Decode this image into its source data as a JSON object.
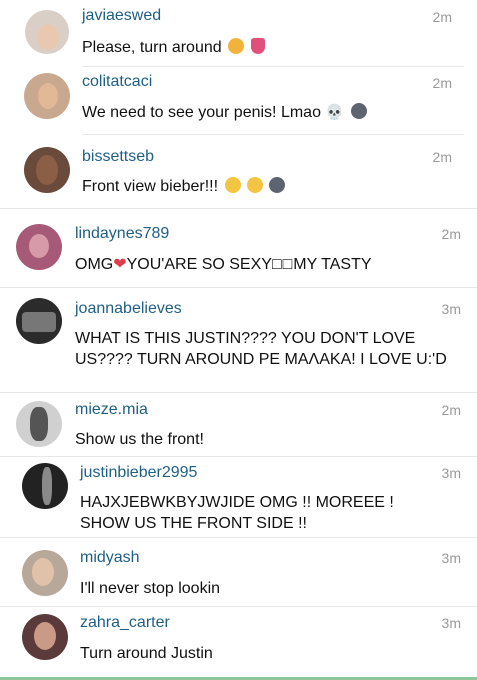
{
  "comments": [
    {
      "username": "javiaeswed",
      "text": "Please, turn around",
      "time": "2m",
      "emoji": [
        "cat-face-heart-eyes",
        "tongue"
      ]
    },
    {
      "username": "colitatcaci",
      "text": "We need to see your penis! Lmao",
      "time": "2m",
      "emoji": [
        "skull",
        "dark-moon-face"
      ]
    },
    {
      "username": "bissettseb",
      "text": "Front view bieber!!!",
      "time": "2m",
      "emoji": [
        "flushed-face",
        "smirk-face",
        "dark-moon-face"
      ]
    },
    {
      "username": "lindaynes789",
      "text_before": "OMG",
      "text_after": "YOU'ARE SO SEXY",
      "text_after2": "MY TASTY",
      "boxes": "□□",
      "time": "2m",
      "emoji": [
        "red-heart"
      ]
    },
    {
      "username": "joannabelieves",
      "text": "WHAT IS THIS JUSTIN???? YOU DON'T LOVE US???? TURN AROUND PE MAΛAKA! I LOVE U:'D",
      "time": "3m"
    },
    {
      "username": "mieze.mia",
      "text": "Show us the front!",
      "time": "2m"
    },
    {
      "username": "justinbieber2995",
      "text": "HAJXJEBWKBYJWJIDE OMG !! MOREEE ! SHOW US THE FRONT SIDE !!",
      "time": "3m"
    },
    {
      "username": "midyash",
      "text": "I'll never stop lookin",
      "time": "3m"
    },
    {
      "username": "zahra_carter",
      "text": "Turn around Justin",
      "time": "3m"
    }
  ],
  "colors": {
    "username": "#1f5f86",
    "text": "#111111",
    "time": "#9a9a9a"
  }
}
